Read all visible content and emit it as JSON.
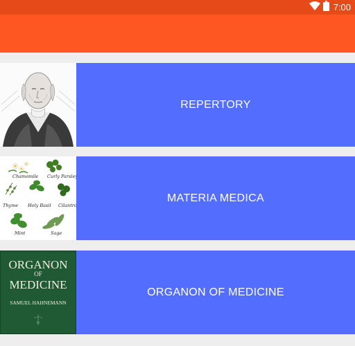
{
  "status_bar": {
    "time": "7:00",
    "icons": [
      "wifi-icon",
      "battery-icon"
    ]
  },
  "colors": {
    "status_bar": "#e64a19",
    "app_bar": "#ff5722",
    "button": "#536dfe",
    "background": "#eeeeee"
  },
  "menu": [
    {
      "label": "REPERTORY",
      "image": "portrait-image"
    },
    {
      "label": "MATERIA MEDICA",
      "image": "herbs-image",
      "herbs": [
        "Chamomile",
        "Curly Parsley",
        "Thyme",
        "Holy Basil",
        "Cilantro",
        "Mint",
        "Sage"
      ]
    },
    {
      "label": "ORGANON OF MEDICINE",
      "image": "book-cover-image",
      "cover": {
        "line1": "ORGANON",
        "line2": "OF",
        "line3": "MEDICINE",
        "author": "SAMUEL HAHNEMANN"
      }
    }
  ]
}
